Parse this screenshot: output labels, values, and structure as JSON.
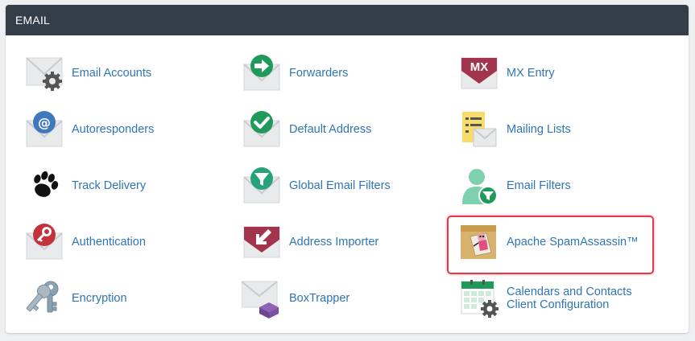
{
  "section": {
    "title": "EMAIL"
  },
  "items": [
    {
      "label": "Email Accounts",
      "icon": "email-accounts-icon"
    },
    {
      "label": "Forwarders",
      "icon": "forwarders-icon"
    },
    {
      "label": "MX Entry",
      "icon": "mx-entry-icon",
      "badge": "MX"
    },
    {
      "label": "Autoresponders",
      "icon": "autoresponders-icon",
      "badge": "@"
    },
    {
      "label": "Default Address",
      "icon": "default-address-icon"
    },
    {
      "label": "Mailing Lists",
      "icon": "mailing-lists-icon"
    },
    {
      "label": "Track Delivery",
      "icon": "track-delivery-icon"
    },
    {
      "label": "Global Email Filters",
      "icon": "global-email-filters-icon"
    },
    {
      "label": "Email Filters",
      "icon": "email-filters-icon"
    },
    {
      "label": "Authentication",
      "icon": "authentication-icon"
    },
    {
      "label": "Address Importer",
      "icon": "address-importer-icon"
    },
    {
      "label": "Apache SpamAssassin™",
      "icon": "apache-spamassassin-icon",
      "highlighted": true
    },
    {
      "label": "Encryption",
      "icon": "encryption-icon"
    },
    {
      "label": "BoxTrapper",
      "icon": "boxtrapper-icon"
    },
    {
      "label_line1": "Calendars and Contacts",
      "label_line2": "Client Configuration",
      "icon": "calendars-contacts-icon"
    }
  ],
  "colors": {
    "header_bg": "#333e48",
    "link": "#2f75b5",
    "green": "#1f9a5a",
    "red": "#c4303b",
    "blue": "#3f78bd",
    "teal": "#27a37c",
    "maroon": "#a3344d",
    "highlight_border": "#e23b4a"
  }
}
